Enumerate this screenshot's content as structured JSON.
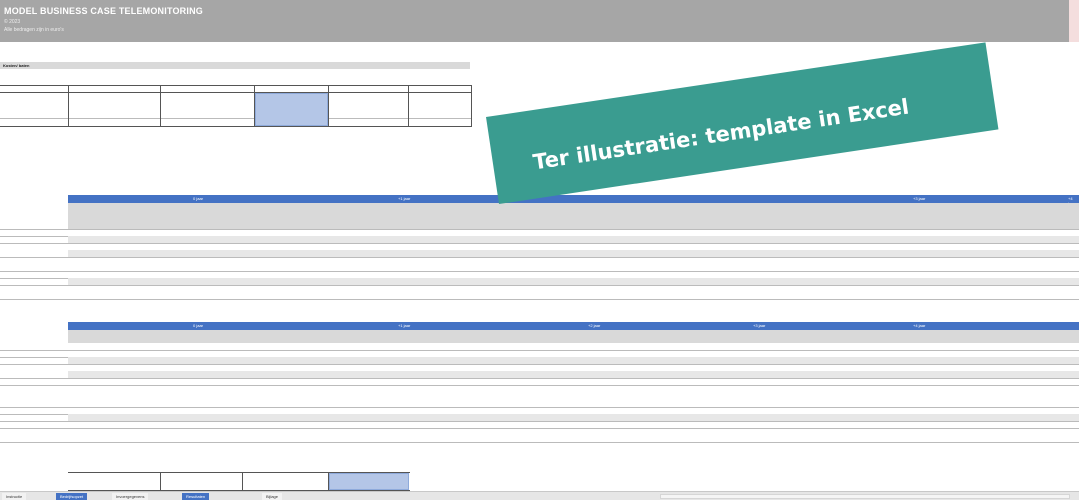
{
  "header": {
    "title": "MODEL BUSINESS CASE TELEMONITORING",
    "subtitle": "© 2023",
    "note": "Alle bedragen zijn in euro's"
  },
  "section": {
    "label": "Kosten/ baten"
  },
  "banner": {
    "text": "Ter illustratie: template in Excel"
  },
  "periods": {
    "year0": "0 jaar",
    "year1": "+1 jaar",
    "year2": "+2 jaar",
    "year3": "+3 jaar",
    "year4": "+4 jaar"
  },
  "tabs": [
    {
      "label": "Instructie"
    },
    {
      "label": "Bedrijfsopzet"
    },
    {
      "label": "Invoergegevens"
    },
    {
      "label": "Resultaten"
    },
    {
      "label": "Bijlage"
    }
  ],
  "colors": {
    "banner": "#3a9c90",
    "header_band": "#4472c4",
    "title_bar": "#a6a6a6"
  }
}
